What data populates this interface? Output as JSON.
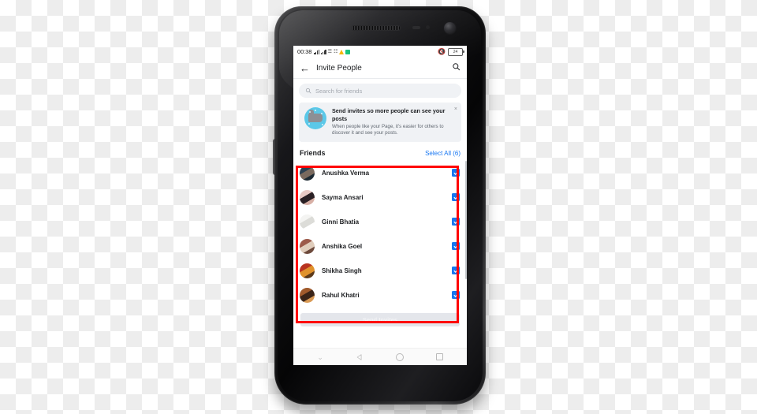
{
  "device": {
    "frame": "android-phone",
    "nav_bar": [
      {
        "name": "hide-keyboard",
        "glyph": "⌄"
      },
      {
        "name": "back",
        "glyph": "◁"
      },
      {
        "name": "home",
        "glyph": "○"
      },
      {
        "name": "recents",
        "glyph": "□"
      }
    ]
  },
  "status_bar": {
    "time": "00:38",
    "battery_level": "24",
    "icons": [
      "signal-bars",
      "signal-bars-2",
      "sim-icon",
      "network-icon",
      "app-badge-yellow",
      "app-badge-green",
      "mute-icon",
      "battery-icon"
    ]
  },
  "app_bar": {
    "back_icon": "←",
    "title": "Invite People",
    "search_icon": "search-icon"
  },
  "search": {
    "placeholder": "Search for friends",
    "value": "",
    "icon": "search-icon"
  },
  "banner": {
    "icon": "thumbs-up-icon",
    "heading": "Send invites so more people can see your posts",
    "body": "When people like your Page, it's easier for others to discover it and see your posts.",
    "close_icon": "×"
  },
  "friends_section": {
    "label": "Friends",
    "select_all_label": "Select All (6)",
    "accent_color": "#1877f2",
    "friends": [
      {
        "name": "Anushka Verma",
        "checked": true,
        "avatar_colors": [
          "#2c4152",
          "#7a6a5e",
          "#1d2a33"
        ]
      },
      {
        "name": "Sayma Ansari",
        "checked": true,
        "avatar_colors": [
          "#e8c9c4",
          "#2a2024",
          "#d8b0a6"
        ]
      },
      {
        "name": "Ginni Bhatia",
        "checked": true,
        "avatar_colors": [
          "#f4f4f2",
          "#dcdcd8",
          "#ffffff"
        ]
      },
      {
        "name": "Anshika Goel",
        "checked": true,
        "avatar_colors": [
          "#9c5a4a",
          "#e0cdbc",
          "#6d4a3c"
        ]
      },
      {
        "name": "Shikha Singh",
        "checked": true,
        "avatar_colors": [
          "#b8331f",
          "#e0922c",
          "#5d3a1a"
        ]
      },
      {
        "name": "Rahul Khatri",
        "checked": true,
        "avatar_colors": [
          "#a05a2c",
          "#3a2418",
          "#d99a55"
        ]
      }
    ]
  },
  "footer": {
    "send_invites_label": "Send Invites",
    "send_invites_enabled": false
  },
  "annotation": {
    "type": "rectangle-highlight",
    "color": "#ff0000",
    "target": "friends-list"
  }
}
